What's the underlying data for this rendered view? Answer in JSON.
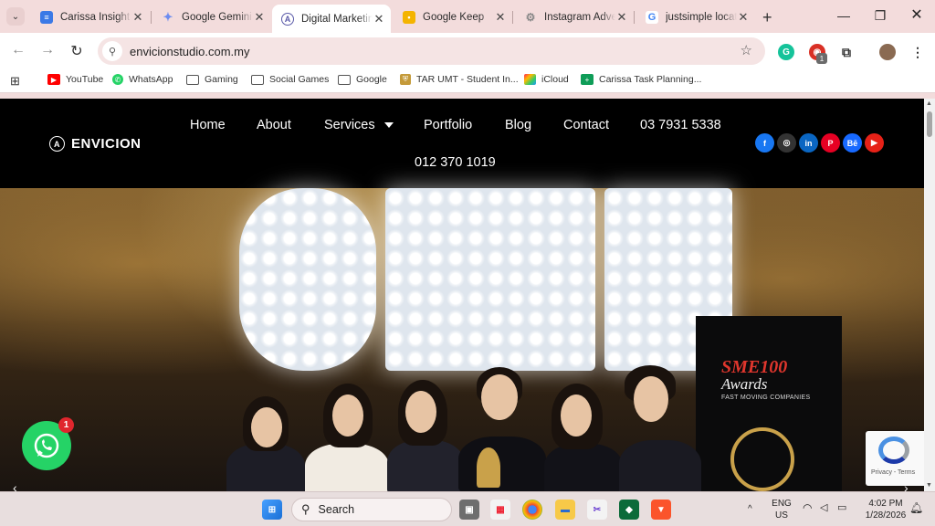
{
  "browser": {
    "tabs": [
      {
        "label": "Carissa Insight B",
        "icon": "docs-icon",
        "color": "#3b79e6",
        "active": false
      },
      {
        "label": "Google Gemini",
        "icon": "gemini-icon",
        "color": "#6c8cf0",
        "active": false
      },
      {
        "label": "Digital Marketing",
        "icon": "envicion-icon",
        "color": "#5a5aa8",
        "active": true
      },
      {
        "label": "Google Keep",
        "icon": "keep-icon",
        "color": "#f4b400",
        "active": false
      },
      {
        "label": "Instagram Adve",
        "icon": "globe-icon",
        "color": "#888888",
        "active": false
      },
      {
        "label": "justsimple locat",
        "icon": "google-icon",
        "color": "#4285f4",
        "active": false
      }
    ],
    "new_tab": "+",
    "url": "envicionstudio.com.my",
    "bookmarks": [
      {
        "label": "YouTube",
        "icon": "youtube-icon"
      },
      {
        "label": "WhatsApp",
        "icon": "whatsapp-icon"
      },
      {
        "label": "Gaming",
        "icon": "folder-icon"
      },
      {
        "label": "Social Games",
        "icon": "folder-icon"
      },
      {
        "label": "Google",
        "icon": "folder-icon"
      },
      {
        "label": "TAR UMT - Student In...",
        "icon": "tarumt-icon"
      },
      {
        "label": "iCloud",
        "icon": "icloud-icon"
      },
      {
        "label": "Carissa Task Planning...",
        "icon": "sheets-icon"
      }
    ],
    "extension_badge": "1"
  },
  "site": {
    "logo": "ENVICION",
    "nav": {
      "home": "Home",
      "about": "About",
      "services": "Services",
      "portfolio": "Portfolio",
      "blog": "Blog",
      "contact": "Contact",
      "phone1": "03 7931 5338",
      "phone2": "012 370 1019"
    },
    "social": [
      {
        "name": "facebook-icon",
        "glyph": "f",
        "color": "#1877f2"
      },
      {
        "name": "instagram-icon",
        "glyph": "◎",
        "color": "#333333"
      },
      {
        "name": "linkedin-icon",
        "glyph": "in",
        "color": "#0a66c2"
      },
      {
        "name": "pinterest-icon",
        "glyph": "P",
        "color": "#e60023"
      },
      {
        "name": "behance-icon",
        "glyph": "Bē",
        "color": "#1769ff"
      },
      {
        "name": "youtube-icon",
        "glyph": "▶",
        "color": "#e62117"
      }
    ],
    "hero": {
      "banner_title": "SME100",
      "banner_subtitle": "Awards",
      "banner_tag": "FAST MOVING COMPANIES"
    },
    "whatsapp_badge": "1",
    "recaptcha_terms": "Privacy - Terms"
  },
  "taskbar": {
    "search_label": "Search",
    "lang_line1": "ENG",
    "lang_line2": "US",
    "time": "4:02 PM",
    "date": "1/28/2026"
  }
}
